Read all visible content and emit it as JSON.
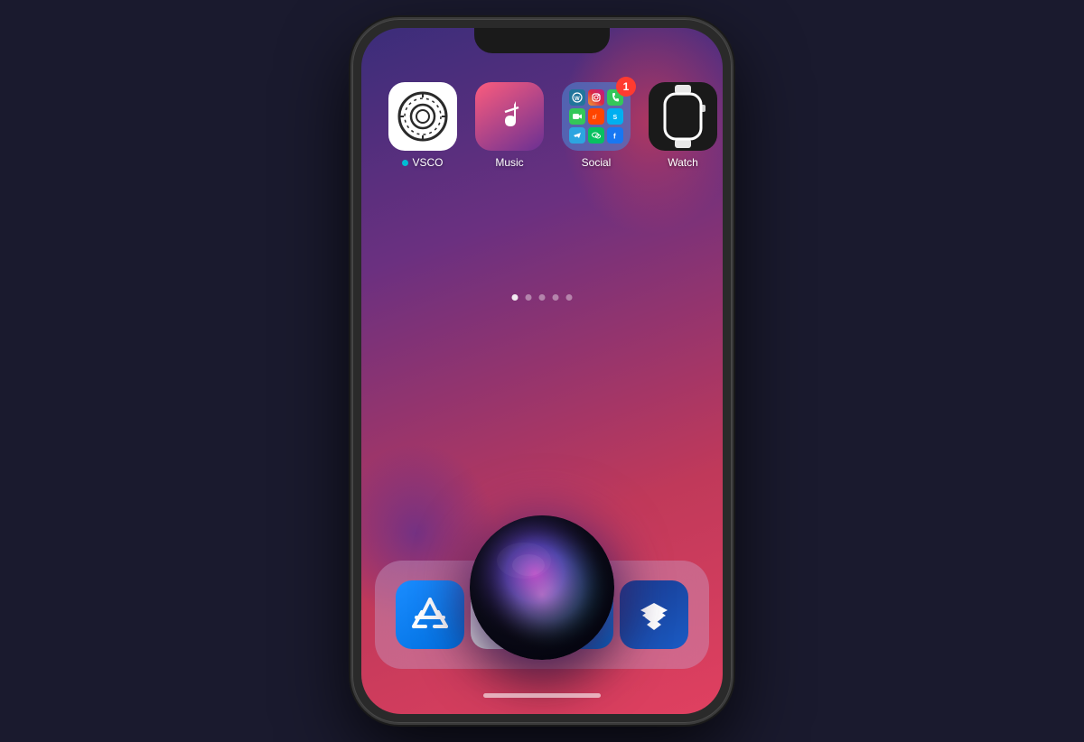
{
  "phone": {
    "apps": [
      {
        "id": "vsco",
        "label": "VSCO",
        "has_dot": true,
        "dot_color": "#00bcd4",
        "badge": null
      },
      {
        "id": "music",
        "label": "Music",
        "has_dot": false,
        "badge": null
      },
      {
        "id": "social",
        "label": "Social",
        "has_dot": false,
        "badge": "1"
      },
      {
        "id": "watch",
        "label": "Watch",
        "has_dot": false,
        "badge": null
      }
    ],
    "dock_apps": [
      {
        "id": "appstore",
        "label": "App Store"
      },
      {
        "id": "safari",
        "label": "Safari"
      },
      {
        "id": "maps",
        "label": "Maps"
      },
      {
        "id": "dropbox",
        "label": "Dropbox"
      }
    ],
    "page_dots": 5,
    "active_dot": 0,
    "siri_active": true
  },
  "colors": {
    "accent_red": "#c0395a",
    "accent_purple": "#6b3080",
    "badge_red": "#ff3b30",
    "vsco_dot": "#00bcd4"
  }
}
